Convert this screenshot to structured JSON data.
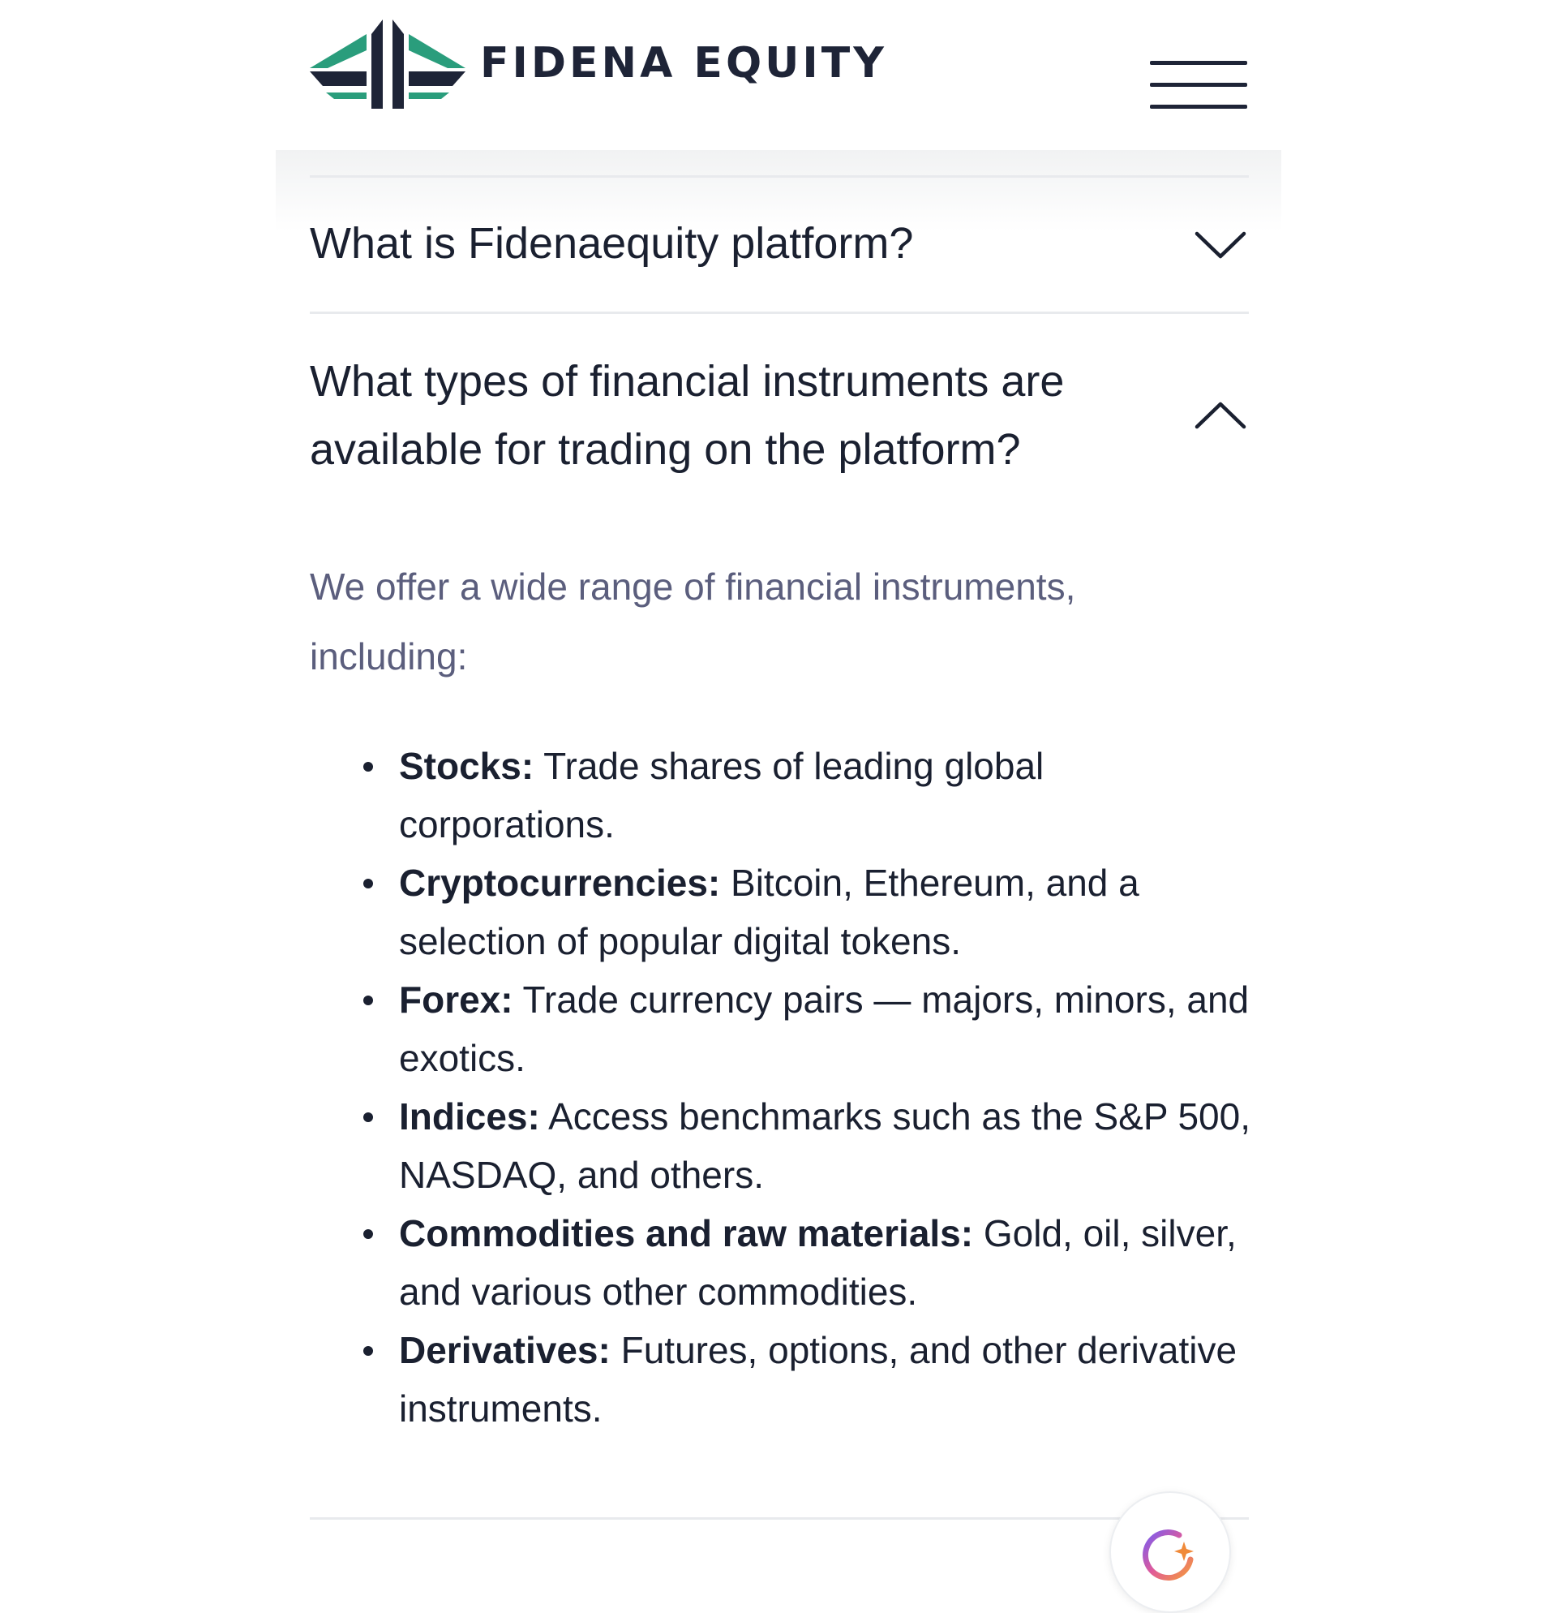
{
  "header": {
    "brand_name": "FIDENA EQUITY",
    "menu_icon": "hamburger-menu-icon",
    "colors": {
      "brand_dark": "#1e2437",
      "brand_green": "#2a9d7c"
    }
  },
  "faq": {
    "items": [
      {
        "question": "What is Fidenaequity platform?",
        "state": "collapsed",
        "icon": "chevron-down-icon"
      },
      {
        "question": "What types of financial instruments are available for trading on the platform?",
        "state": "expanded",
        "icon": "chevron-up-icon",
        "answer_intro": "We offer a wide range of financial instruments, including:",
        "answer_list": [
          {
            "term": "Stocks:",
            "text": " Trade shares of leading global corporations."
          },
          {
            "term": "Cryptocurrencies:",
            "text": " Bitcoin, Ethereum, and a selection of popular digital tokens."
          },
          {
            "term": "Forex:",
            "text": " Trade currency pairs — majors, minors, and exotics."
          },
          {
            "term": "Indices:",
            "text": " Access benchmarks such as the S&P 500, NASDAQ, and others."
          },
          {
            "term": "Commodities and raw materials:",
            "text": " Gold, oil, silver, and various other commodities."
          },
          {
            "term": "Derivatives:",
            "text": " Futures, options, and other derivative instruments."
          }
        ]
      }
    ]
  },
  "assistant": {
    "icon": "assistant-spark-icon"
  }
}
